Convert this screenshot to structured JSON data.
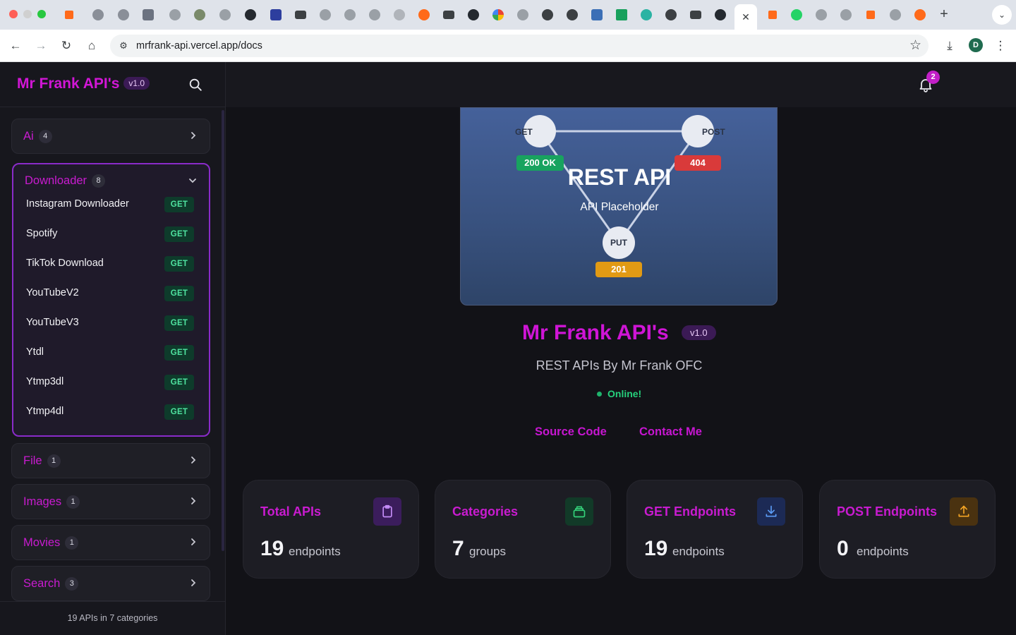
{
  "browser": {
    "url": "mrfrank-api.vercel.app/docs",
    "profile_initial": "D"
  },
  "sidebar": {
    "brand": "Mr Frank API's",
    "version": "v1.0",
    "categories": [
      {
        "name": "Ai",
        "count": "4"
      },
      {
        "name": "Downloader",
        "count": "8"
      },
      {
        "name": "File",
        "count": "1"
      },
      {
        "name": "Images",
        "count": "1"
      },
      {
        "name": "Movies",
        "count": "1"
      },
      {
        "name": "Search",
        "count": "3"
      }
    ],
    "downloader_items": [
      {
        "name": "Instagram Downloader",
        "method": "GET"
      },
      {
        "name": "Spotify",
        "method": "GET"
      },
      {
        "name": "TikTok Download",
        "method": "GET"
      },
      {
        "name": "YouTubeV2",
        "method": "GET"
      },
      {
        "name": "YouTubeV3",
        "method": "GET"
      },
      {
        "name": "Ytdl",
        "method": "GET"
      },
      {
        "name": "Ytmp3dl",
        "method": "GET"
      },
      {
        "name": "Ytmp4dl",
        "method": "GET"
      }
    ],
    "footer": "19 APIs in 7 categories"
  },
  "header": {
    "notification_count": "2"
  },
  "hero": {
    "title": "REST API",
    "subtitle": "API Placeholder",
    "nodes": {
      "get": "GET",
      "post": "POST",
      "put": "PUT"
    },
    "badges": {
      "ok": "200 OK",
      "not_found": "404",
      "created": "201"
    }
  },
  "main": {
    "title": "Mr Frank API's",
    "version": "v1.0",
    "subtitle": "REST APIs By Mr Frank OFC",
    "status": "Online!",
    "links": {
      "source": "Source Code",
      "contact": "Contact Me"
    },
    "stats": [
      {
        "title": "Total APIs",
        "value": "19",
        "unit": "endpoints",
        "icon": "clipboard-icon",
        "color": "#a855f7"
      },
      {
        "title": "Categories",
        "value": "7",
        "unit": "groups",
        "icon": "layers-icon",
        "color": "#22c55e"
      },
      {
        "title": "GET Endpoints",
        "value": "19",
        "unit": "endpoints",
        "icon": "download-icon",
        "color": "#3b82f6"
      },
      {
        "title": "POST Endpoints",
        "value": "0",
        "unit": "endpoints",
        "icon": "upload-icon",
        "color": "#f59e0b"
      }
    ]
  },
  "colors": {
    "accent": "#c91bd0",
    "online": "#26d07c",
    "get_badge": "#4fe3a0"
  }
}
